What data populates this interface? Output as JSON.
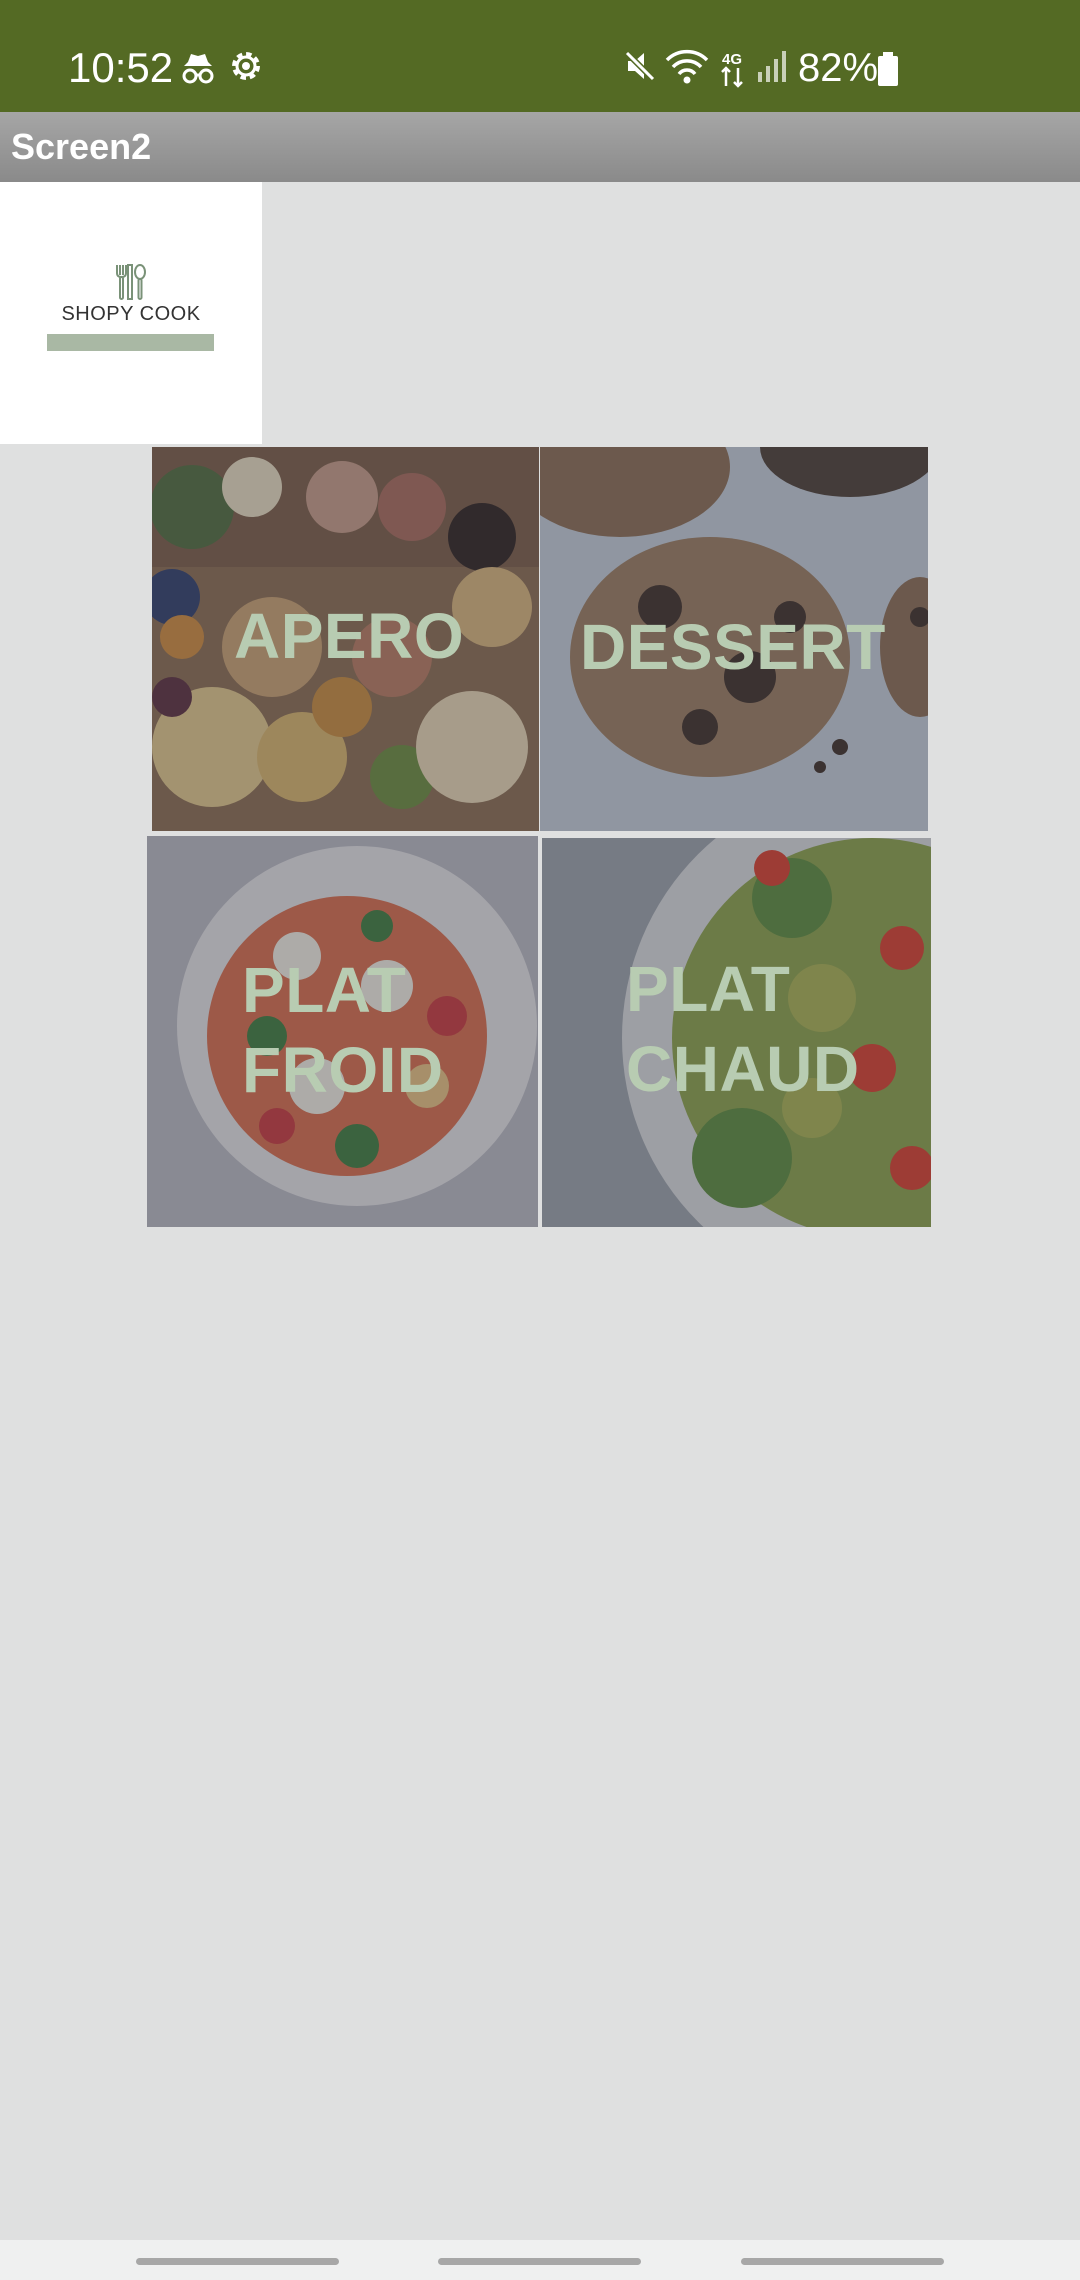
{
  "status_bar": {
    "time": "10:52",
    "battery": "82%",
    "network": "4G",
    "icons": [
      "incognito-icon",
      "settings-gear-icon",
      "mute-icon",
      "wifi-icon",
      "mobile-data-icon",
      "signal-icon",
      "battery-icon"
    ]
  },
  "app_bar": {
    "title": "Screen2"
  },
  "logo": {
    "name": "SHOPY COOK",
    "icon": "cutlery-icon"
  },
  "tiles": [
    {
      "id": "apero",
      "lines": [
        "APERO"
      ]
    },
    {
      "id": "dessert",
      "lines": [
        "DESSERT"
      ]
    },
    {
      "id": "plat-froid",
      "lines": [
        "PLAT",
        "FROID"
      ]
    },
    {
      "id": "plat-chaud",
      "lines": [
        "PLAT",
        "CHAUD"
      ]
    }
  ],
  "colors": {
    "status_bar": "#546a24",
    "background": "#dfe0e0",
    "tile_text": "#b8ccb2",
    "logo_accent": "#a9b8a4"
  }
}
